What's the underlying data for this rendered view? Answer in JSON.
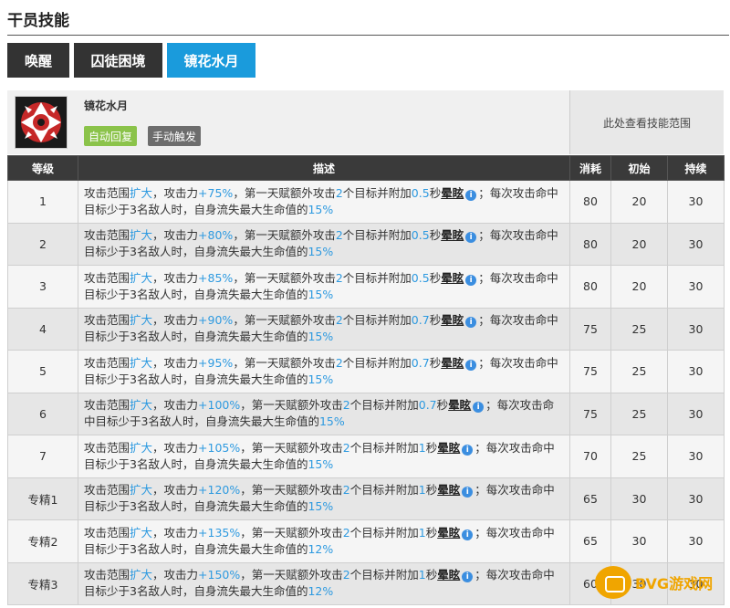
{
  "section": {
    "title": "干员技能"
  },
  "tabs": [
    {
      "label": "唤醒",
      "active": false
    },
    {
      "label": "囚徒困境",
      "active": false
    },
    {
      "label": "镜花水月",
      "active": true
    }
  ],
  "skill": {
    "icon": "skill-icon-red-white",
    "name": "镜花水月",
    "tags": {
      "recovery": "自动回复",
      "trigger": "手动触发"
    },
    "range_text": "此处查看技能范围"
  },
  "table": {
    "headers": {
      "level": "等级",
      "desc": "描述",
      "cost": "消耗",
      "initial": "初始",
      "duration": "持续"
    },
    "rows": [
      {
        "level": "1",
        "atk": "+75%",
        "stun": "0.5",
        "cost": "80",
        "initial": "20",
        "duration": "30"
      },
      {
        "level": "2",
        "atk": "+80%",
        "stun": "0.5",
        "cost": "80",
        "initial": "20",
        "duration": "30"
      },
      {
        "level": "3",
        "atk": "+85%",
        "stun": "0.5",
        "cost": "80",
        "initial": "20",
        "duration": "30"
      },
      {
        "level": "4",
        "atk": "+90%",
        "stun": "0.7",
        "cost": "75",
        "initial": "25",
        "duration": "30"
      },
      {
        "level": "5",
        "atk": "+95%",
        "stun": "0.7",
        "cost": "75",
        "initial": "25",
        "duration": "30"
      },
      {
        "level": "6",
        "atk": "+100%",
        "stun": "0.7",
        "cost": "75",
        "initial": "25",
        "duration": "30"
      },
      {
        "level": "7",
        "atk": "+105%",
        "stun": "1",
        "cost": "70",
        "initial": "25",
        "duration": "30"
      },
      {
        "level": "专精1",
        "atk": "+120%",
        "stun": "1",
        "cost": "65",
        "initial": "30",
        "duration": "30"
      },
      {
        "level": "专精2",
        "atk": "+135%",
        "stun": "1",
        "cost": "65",
        "initial": "30",
        "duration": "30"
      },
      {
        "level": "专精3",
        "atk": "+150%",
        "stun": "1",
        "cost": "60",
        "initial": "30",
        "duration": "30"
      }
    ],
    "desc_parts": {
      "p1": "攻击范围",
      "range": "扩大",
      "p2": "，攻击力",
      "p3": "，第一天赋额外攻击",
      "targets": "2",
      "p4": "个目标并附加",
      "p5": "秒",
      "stun_word": "晕眩",
      "info_glyph": "i",
      "p6": "；每次攻击命中目标少于3名敌人时，自身流失最大生命值的",
      "pct_15": "15%",
      "pct_12": "12%"
    }
  },
  "watermark": {
    "text": "BVG游戏网"
  },
  "colors": {
    "accent": "#1a9bdc",
    "highlight": "#2e9ae0",
    "header": "#3a3a3a",
    "tag_green": "#8bc34a"
  }
}
